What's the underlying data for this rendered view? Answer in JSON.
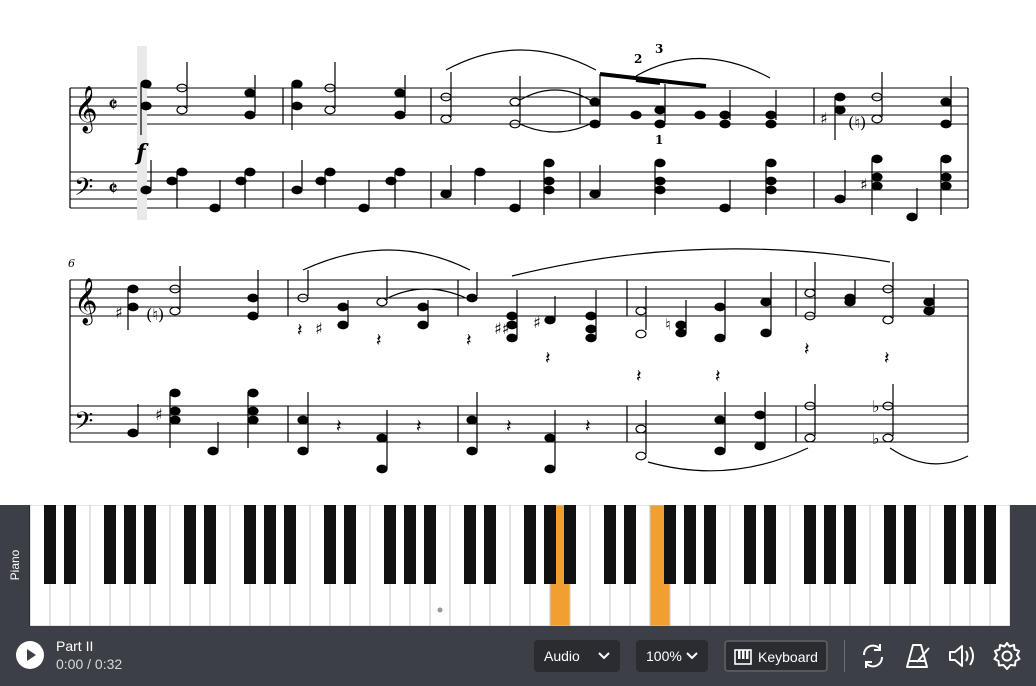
{
  "score": {
    "measure_number": "6",
    "dynamic": "f",
    "tuplet_top_left": "2",
    "tuplet_top_right": "3",
    "fingering_below": "1"
  },
  "piano": {
    "instrument_label": "Piano",
    "highlighted_color": "#f0a030"
  },
  "controls": {
    "part_name": "Part II",
    "time": "0:00 / 0:32",
    "audio_label": "Audio",
    "zoom_label": "100%",
    "keyboard_label": "Keyboard"
  },
  "icons": [
    "play-icon",
    "chevron-down-icon",
    "piano-keys-icon",
    "loop-icon",
    "metronome-icon",
    "volume-icon",
    "gear-icon"
  ]
}
